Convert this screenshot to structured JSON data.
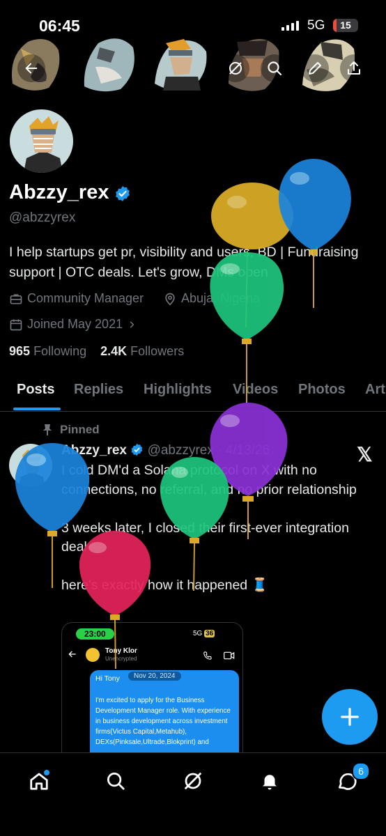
{
  "status_bar": {
    "time": "06:45",
    "network": "5G",
    "battery": "15",
    "battery_level": 0.15
  },
  "profile": {
    "display_name": "Abzzy_rex",
    "handle": "@abzzyrex",
    "bio": "I help startups get pr, visibility and users, BD | Fundraising support | OTC deals. Let's grow, DMs open",
    "category": "Community Manager",
    "location": "Abuja, Nigeria",
    "joined": "Joined May 2021",
    "following_count": "965",
    "following_label": "Following",
    "followers_count": "2.4K",
    "followers_label": "Followers"
  },
  "tabs": [
    "Posts",
    "Replies",
    "Highlights",
    "Videos",
    "Photos",
    "Art"
  ],
  "post": {
    "pinned_label": "Pinned",
    "author_name": "Abzzy_rex",
    "author_handle": "@abzzyrex · 4/13/26",
    "text": "I cold DM'd a Solana protocol on X with no connections, no referral, and no prior relationship\n\n3 weeks later, I closed their first-ever integration deal\n\nhere's exactly how it happened 🧵",
    "embed": {
      "time": "23:00",
      "network": "5G",
      "battery": "36",
      "contact_name": "Tony Klor",
      "contact_status": "Unencrypted",
      "date_badge": "Nov 20, 2024",
      "greeting": "Hi Tony",
      "message": "I'm excited to apply for the Business Development Manager role. With experience in business development across investment firms(Victus Capital,Metahub), DEXs(Pinksale,Ultrade,Blokprint) and"
    }
  },
  "bottom_nav": {
    "items": [
      "home-icon",
      "search-icon",
      "grok-icon",
      "notifications-icon",
      "messages-icon"
    ],
    "messages_badge": "6"
  },
  "colors": {
    "accent": "#1d9bf0",
    "muted": "#71767b",
    "text": "#e7e9ea",
    "background": "#000000"
  }
}
